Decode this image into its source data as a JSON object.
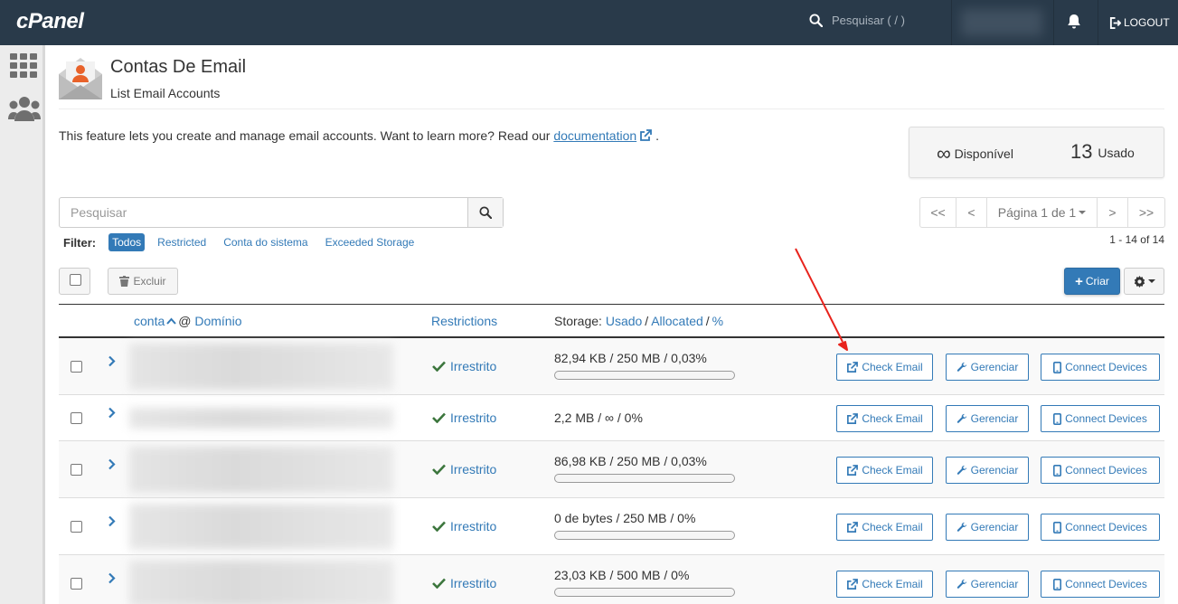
{
  "topbar": {
    "logo": "cPanel",
    "search_placeholder": "Pesquisar ( / )",
    "logout_label": "LOGOUT"
  },
  "sidebar": {
    "items": [
      {
        "icon": "grid-icon"
      },
      {
        "icon": "users-icon"
      }
    ]
  },
  "page": {
    "title": "Contas De Email",
    "subtitle": "List Email Accounts",
    "intro_text": "This feature lets you create and manage email accounts. Want to learn more? Read our ",
    "intro_link": "documentation",
    "intro_end": "."
  },
  "stats": {
    "available_value": "∞",
    "available_label": "Disponível",
    "used_value": "13",
    "used_label": "Usado"
  },
  "search": {
    "placeholder": "Pesquisar"
  },
  "filter": {
    "label": "Filter:",
    "options": [
      "Todos",
      "Restricted",
      "Conta do sistema",
      "Exceeded Storage"
    ],
    "active": "Todos"
  },
  "pager": {
    "first": "<<",
    "prev": "<",
    "page_label": "Página 1 de 1",
    "next": ">",
    "last": ">>",
    "count": "1 - 14 of 14"
  },
  "toolbar": {
    "delete_label": "Excluir",
    "create_label": "Criar"
  },
  "table": {
    "col_account": "conta",
    "col_at": "@",
    "col_domain": "Domínio",
    "col_restrictions": "Restrictions",
    "col_storage_prefix": "Storage:",
    "col_storage_used": "Usado",
    "col_storage_allocated": "Allocated",
    "col_storage_percent": "%",
    "rows": [
      {
        "restriction": "Irrestrito",
        "storage": "82,94 KB / 250 MB / 0,03%",
        "bar": true,
        "usage_fraction": 0.0003
      },
      {
        "restriction": "Irrestrito",
        "storage": "2,2 MB / ∞ / 0%",
        "bar": false,
        "usage_fraction": 0
      },
      {
        "restriction": "Irrestrito",
        "storage": "86,98 KB / 250 MB / 0,03%",
        "bar": true,
        "usage_fraction": 0.0003
      },
      {
        "restriction": "Irrestrito",
        "storage": "0 de bytes / 250 MB / 0%",
        "bar": true,
        "usage_fraction": 0
      },
      {
        "restriction": "Irrestrito",
        "storage": "23,03 KB / 500 MB / 0%",
        "bar": true,
        "usage_fraction": 0
      }
    ],
    "actions": {
      "check_email": "Check Email",
      "manage": "Gerenciar",
      "connect": "Connect Devices"
    }
  },
  "colors": {
    "topbar": "#293a4a",
    "link": "#337ab7",
    "success": "#3c763d",
    "annotation_arrow": "#e8231c"
  }
}
